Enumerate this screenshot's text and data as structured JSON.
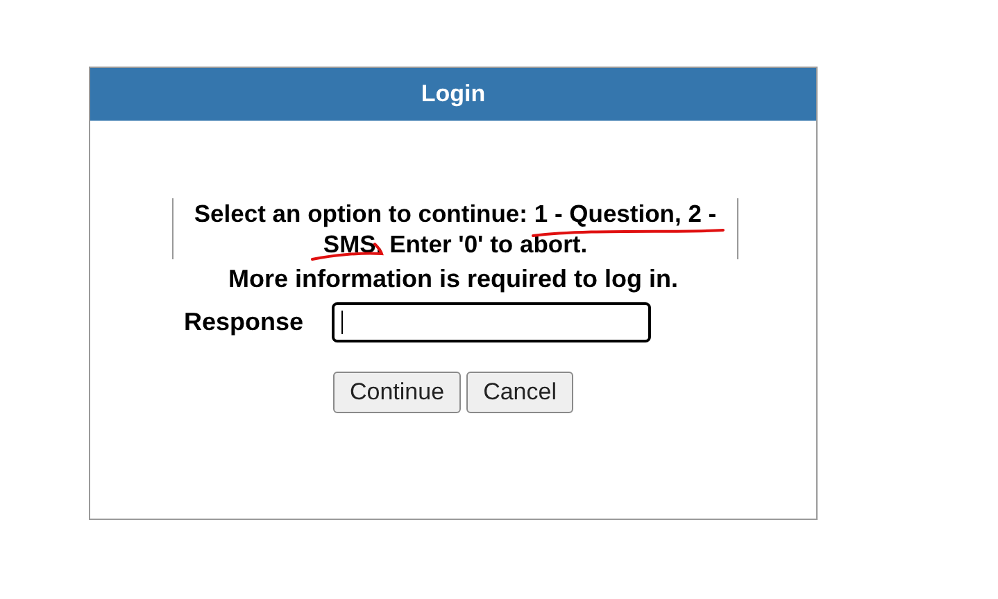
{
  "dialog": {
    "title": "Login",
    "message": "Select an option to continue: 1 - Question, 2 - SMS. Enter '0' to abort.",
    "info": "More information is required to log in.",
    "field": {
      "label": "Response",
      "focused": true
    },
    "buttons": [
      "Continue",
      "Cancel"
    ]
  }
}
